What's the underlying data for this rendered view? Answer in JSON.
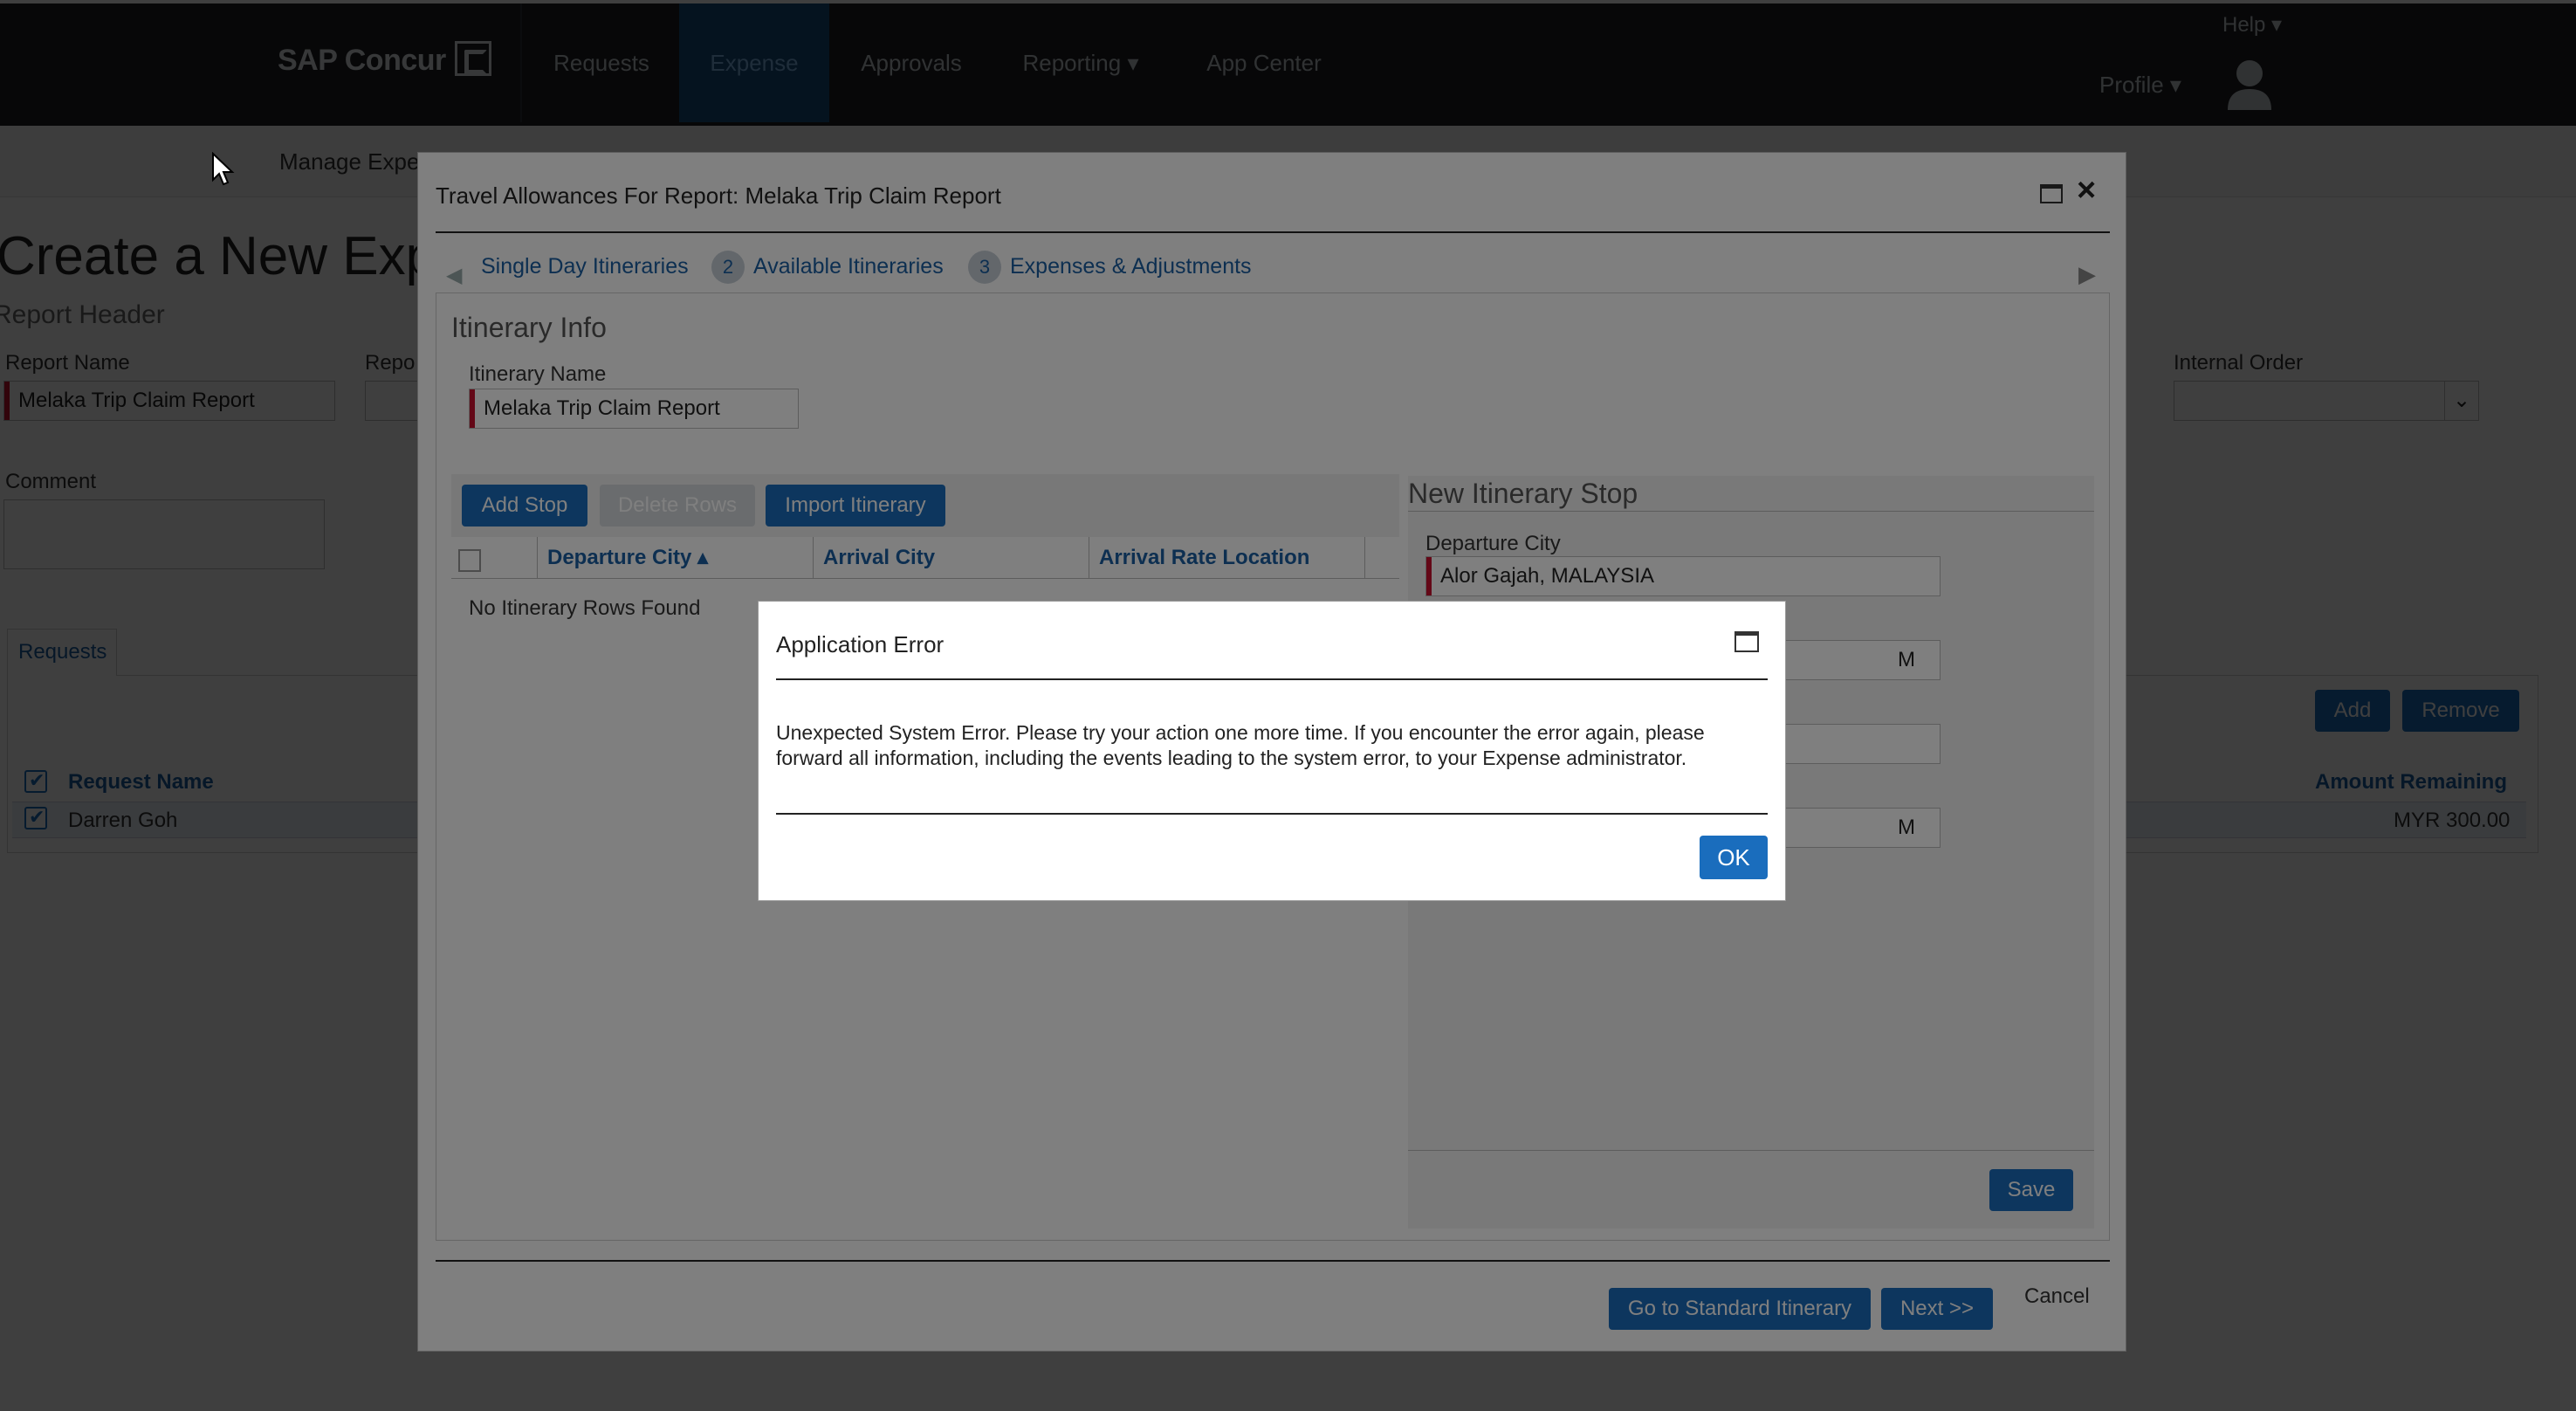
{
  "brand": "SAP Concur",
  "nav": {
    "items": [
      "Requests",
      "Expense",
      "Approvals",
      "Reporting ▾",
      "App Center"
    ],
    "help": "Help ▾",
    "profile": "Profile ▾"
  },
  "subbar": {
    "label": "Manage Expe"
  },
  "page": {
    "title": "Create a New Expe",
    "section": "Report Header",
    "report_name_label": "Report Name",
    "report_name_value": "Melaka Trip Claim Report",
    "repo_label": "Repo",
    "internal_order_label": "Internal Order",
    "comment_label": "Comment",
    "requests_tab": "Requests",
    "add_label": "Add",
    "remove_label": "Remove",
    "col_request_name": "Request Name",
    "col_amount_remaining": "Amount Remaining",
    "row_name": "Darren Goh",
    "row_amount": "MYR 300.00"
  },
  "modal": {
    "title": "Travel Allowances For Report: Melaka Trip Claim Report",
    "steps": [
      {
        "num": "",
        "label": "Single Day Itineraries"
      },
      {
        "num": "2",
        "label": "Available Itineraries"
      },
      {
        "num": "3",
        "label": "Expenses & Adjustments"
      }
    ],
    "itinerary_info": "Itinerary Info",
    "itinerary_name_label": "Itinerary Name",
    "itinerary_name_value": "Melaka Trip Claim Report",
    "add_stop": "Add Stop",
    "delete_rows": "Delete Rows",
    "import_itinerary": "Import Itinerary",
    "columns": [
      "Departure City ▴",
      "Arrival City",
      "Arrival Rate Location"
    ],
    "no_rows": "No Itinerary Rows Found",
    "new_stop": "New Itinerary Stop",
    "departure_city_label": "Departure City",
    "departure_city_value": "Alor Gajah, MALAYSIA",
    "partial_field_1": "M",
    "partial_field_3": "M",
    "save": "Save",
    "go_standard": "Go to Standard Itinerary",
    "next": "Next >>",
    "cancel": "Cancel"
  },
  "error_dialog": {
    "title": "Application Error",
    "message": "Unexpected System Error. Please try your action one more time. If you encounter the error again, please forward all information, including the events leading to the system error, to your Expense administrator.",
    "ok": "OK"
  },
  "colors": {
    "topbar": "#1c1f23",
    "active_tab": "#174c7d",
    "primary_button": "#1a6dbd",
    "required_marker": "#c8102e"
  }
}
